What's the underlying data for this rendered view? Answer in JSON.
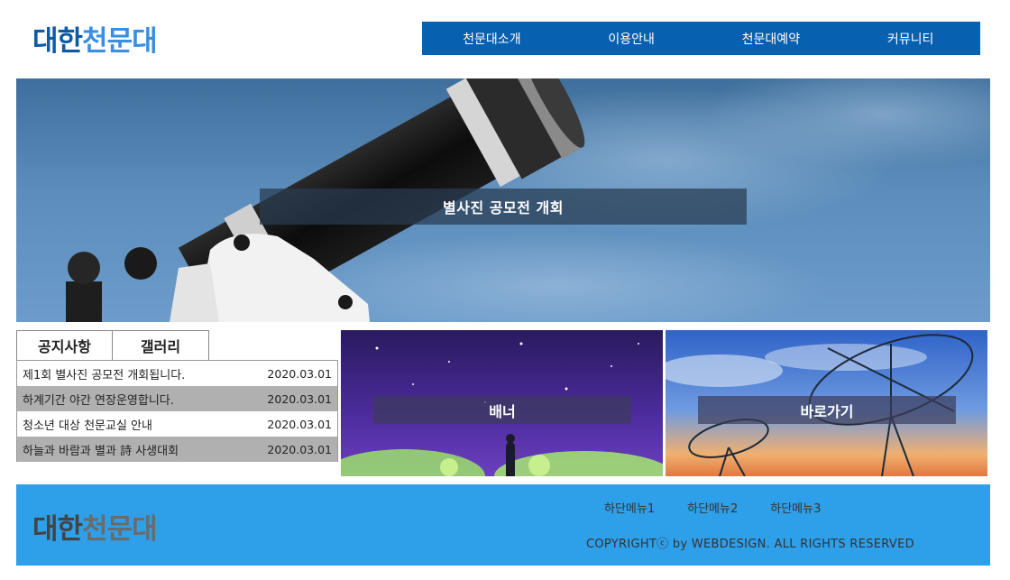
{
  "header": {
    "logo_part1": "대한",
    "logo_part2": "천문대"
  },
  "nav": {
    "items": [
      "천문대소개",
      "이용안내",
      "천문대예약",
      "커뮤니티"
    ]
  },
  "hero": {
    "caption": "별사진 공모전 개회"
  },
  "tabs": [
    "공지사항",
    "갤러리"
  ],
  "notices": [
    {
      "title": "제1회 별사진 공모전 개회됩니다.",
      "date": "2020.03.01"
    },
    {
      "title": "하계기간 야간 연장운영합니다.",
      "date": "2020.03.01"
    },
    {
      "title": "청소년 대상 천문교실 안내",
      "date": "2020.03.01"
    },
    {
      "title": "하늘과 바람과 별과 詩 사생대회",
      "date": "2020.03.01"
    }
  ],
  "banners": {
    "banner_label": "배너",
    "shortcut_label": "바로가기"
  },
  "footer": {
    "logo_part1": "대한",
    "logo_part2": "천문대",
    "menu": [
      "하단메뉴1",
      "하단메뉴2",
      "하단메뉴3"
    ],
    "copyright": "COPYRIGHTⓒ by WEBDESIGN. ALL RIGHTS RESERVED"
  },
  "colors": {
    "nav_bg": "#0860b0",
    "footer_bg": "#2e9fe9",
    "logo_dark": "#0d5aa7",
    "logo_light": "#3a8fe0"
  }
}
